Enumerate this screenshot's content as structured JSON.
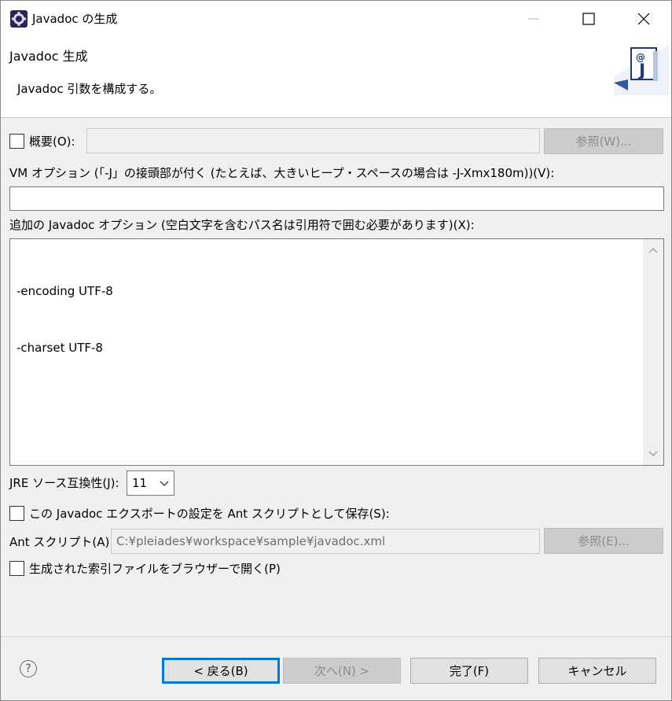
{
  "window": {
    "title": "Javadoc の生成",
    "minimize_icon": "minimize-icon",
    "maximize_icon": "maximize-icon",
    "close_icon": "close-icon"
  },
  "banner": {
    "title": "Javadoc 生成",
    "description": "Javadoc 引数を構成する。",
    "graphic_icon": "javadoc-wizard-icon",
    "graphic_text": "@J"
  },
  "overview": {
    "label": "概要(O):",
    "checked": false,
    "value": "",
    "browse_label": "参照(W)..."
  },
  "vm_options": {
    "label": "VM オプション (「-J」の接頭部が付く (たとえば、大きいヒープ・スペースの場合は -J-Xmx180m))(V):",
    "value": ""
  },
  "extra_options": {
    "label": "追加の Javadoc オプション (空白文字を含むパス名は引用符で囲む必要があります)(X):",
    "lines": [
      "-encoding UTF-8",
      "-charset UTF-8"
    ]
  },
  "jre_compat": {
    "label": "JRE ソース互換性(J):",
    "selected": "11"
  },
  "save_ant": {
    "label": "この Javadoc エクスポートの設定を Ant スクリプトとして保存(S):",
    "checked": false
  },
  "ant_script": {
    "label": "Ant スクリプト(A):",
    "value": "C:¥pleiades¥workspace¥sample¥javadoc.xml",
    "browse_label": "参照(E)..."
  },
  "open_browser": {
    "label": "生成された索引ファイルをブラウザーで開く(P)",
    "checked": false
  },
  "footer": {
    "help_icon": "help-icon",
    "help_glyph": "?",
    "back_label": "< 戻る(B)",
    "next_label": "次へ(N) >",
    "finish_label": "完了(F)",
    "cancel_label": "キャンセル"
  }
}
